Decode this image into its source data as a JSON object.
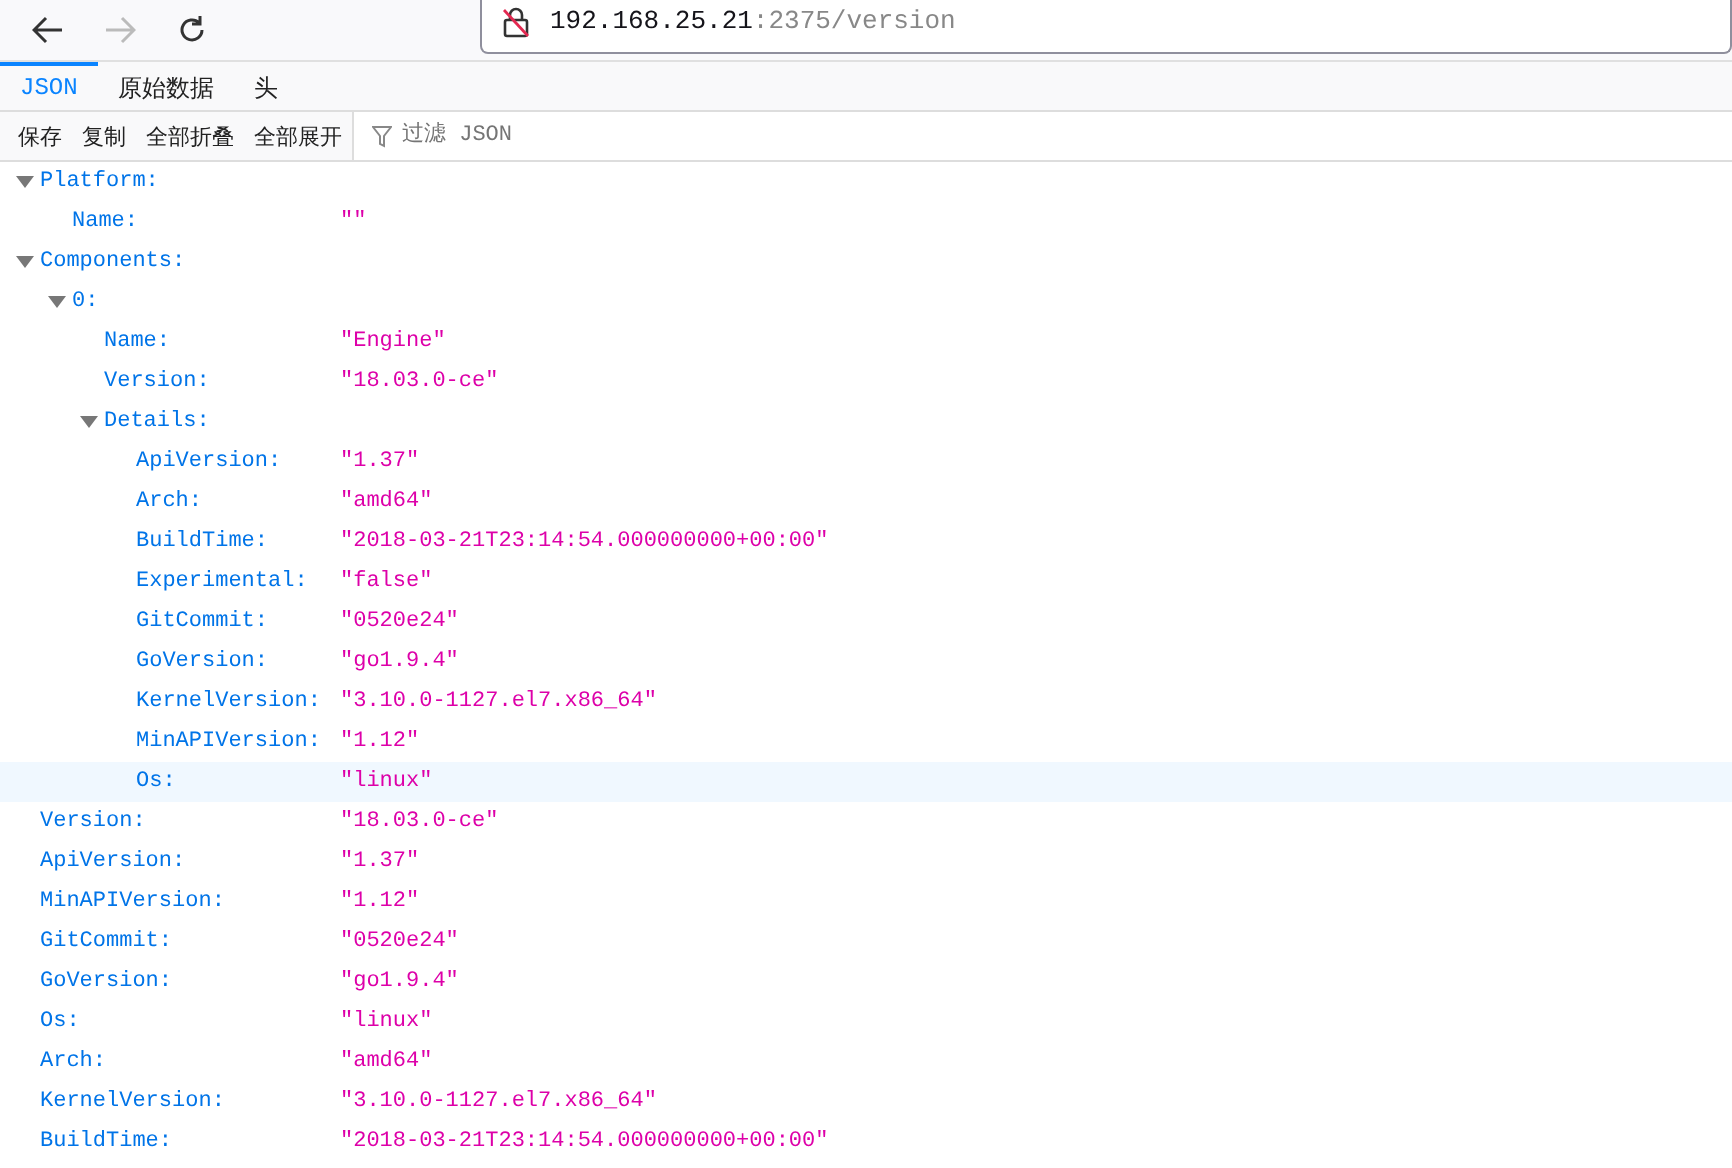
{
  "nav": {
    "url_host": "192.168.25.21",
    "url_rest": ":2375/version"
  },
  "tabs": [
    {
      "label": "JSON",
      "selected": true
    },
    {
      "label": "原始数据",
      "selected": false
    },
    {
      "label": "头",
      "selected": false
    }
  ],
  "toolbar": {
    "buttons": [
      "保存",
      "复制",
      "全部折叠",
      "全部展开"
    ],
    "filter_placeholder": "过滤 JSON"
  },
  "tree": [
    {
      "key": "Platform:",
      "expanded": true,
      "selected": false,
      "children": [
        {
          "key": "Name:",
          "value": "\"\"",
          "selected": false
        }
      ]
    },
    {
      "key": "Components:",
      "expanded": true,
      "selected": false,
      "children": [
        {
          "key": "0:",
          "expanded": true,
          "selected": false,
          "children": [
            {
              "key": "Name:",
              "value": "\"Engine\"",
              "selected": false
            },
            {
              "key": "Version:",
              "value": "\"18.03.0-ce\"",
              "selected": false
            },
            {
              "key": "Details:",
              "expanded": true,
              "selected": false,
              "children": [
                {
                  "key": "ApiVersion:",
                  "value": "\"1.37\"",
                  "selected": false
                },
                {
                  "key": "Arch:",
                  "value": "\"amd64\"",
                  "selected": false
                },
                {
                  "key": "BuildTime:",
                  "value": "\"2018-03-21T23:14:54.000000000+00:00\"",
                  "selected": false
                },
                {
                  "key": "Experimental:",
                  "value": "\"false\"",
                  "selected": false
                },
                {
                  "key": "GitCommit:",
                  "value": "\"0520e24\"",
                  "selected": false
                },
                {
                  "key": "GoVersion:",
                  "value": "\"go1.9.4\"",
                  "selected": false
                },
                {
                  "key": "KernelVersion:",
                  "value": "\"3.10.0-1127.el7.x86_64\"",
                  "selected": false
                },
                {
                  "key": "MinAPIVersion:",
                  "value": "\"1.12\"",
                  "selected": false
                },
                {
                  "key": "Os:",
                  "value": "\"linux\"",
                  "selected": true
                }
              ]
            }
          ]
        }
      ]
    },
    {
      "key": "Version:",
      "value": "\"18.03.0-ce\"",
      "selected": false
    },
    {
      "key": "ApiVersion:",
      "value": "\"1.37\"",
      "selected": false
    },
    {
      "key": "MinAPIVersion:",
      "value": "\"1.12\"",
      "selected": false
    },
    {
      "key": "GitCommit:",
      "value": "\"0520e24\"",
      "selected": false
    },
    {
      "key": "GoVersion:",
      "value": "\"go1.9.4\"",
      "selected": false
    },
    {
      "key": "Os:",
      "value": "\"linux\"",
      "selected": false
    },
    {
      "key": "Arch:",
      "value": "\"amd64\"",
      "selected": false
    },
    {
      "key": "KernelVersion:",
      "value": "\"3.10.0-1127.el7.x86_64\"",
      "selected": false
    },
    {
      "key": "BuildTime:",
      "value": "\"2018-03-21T23:14:54.000000000+00:00\"",
      "selected": false
    }
  ]
}
